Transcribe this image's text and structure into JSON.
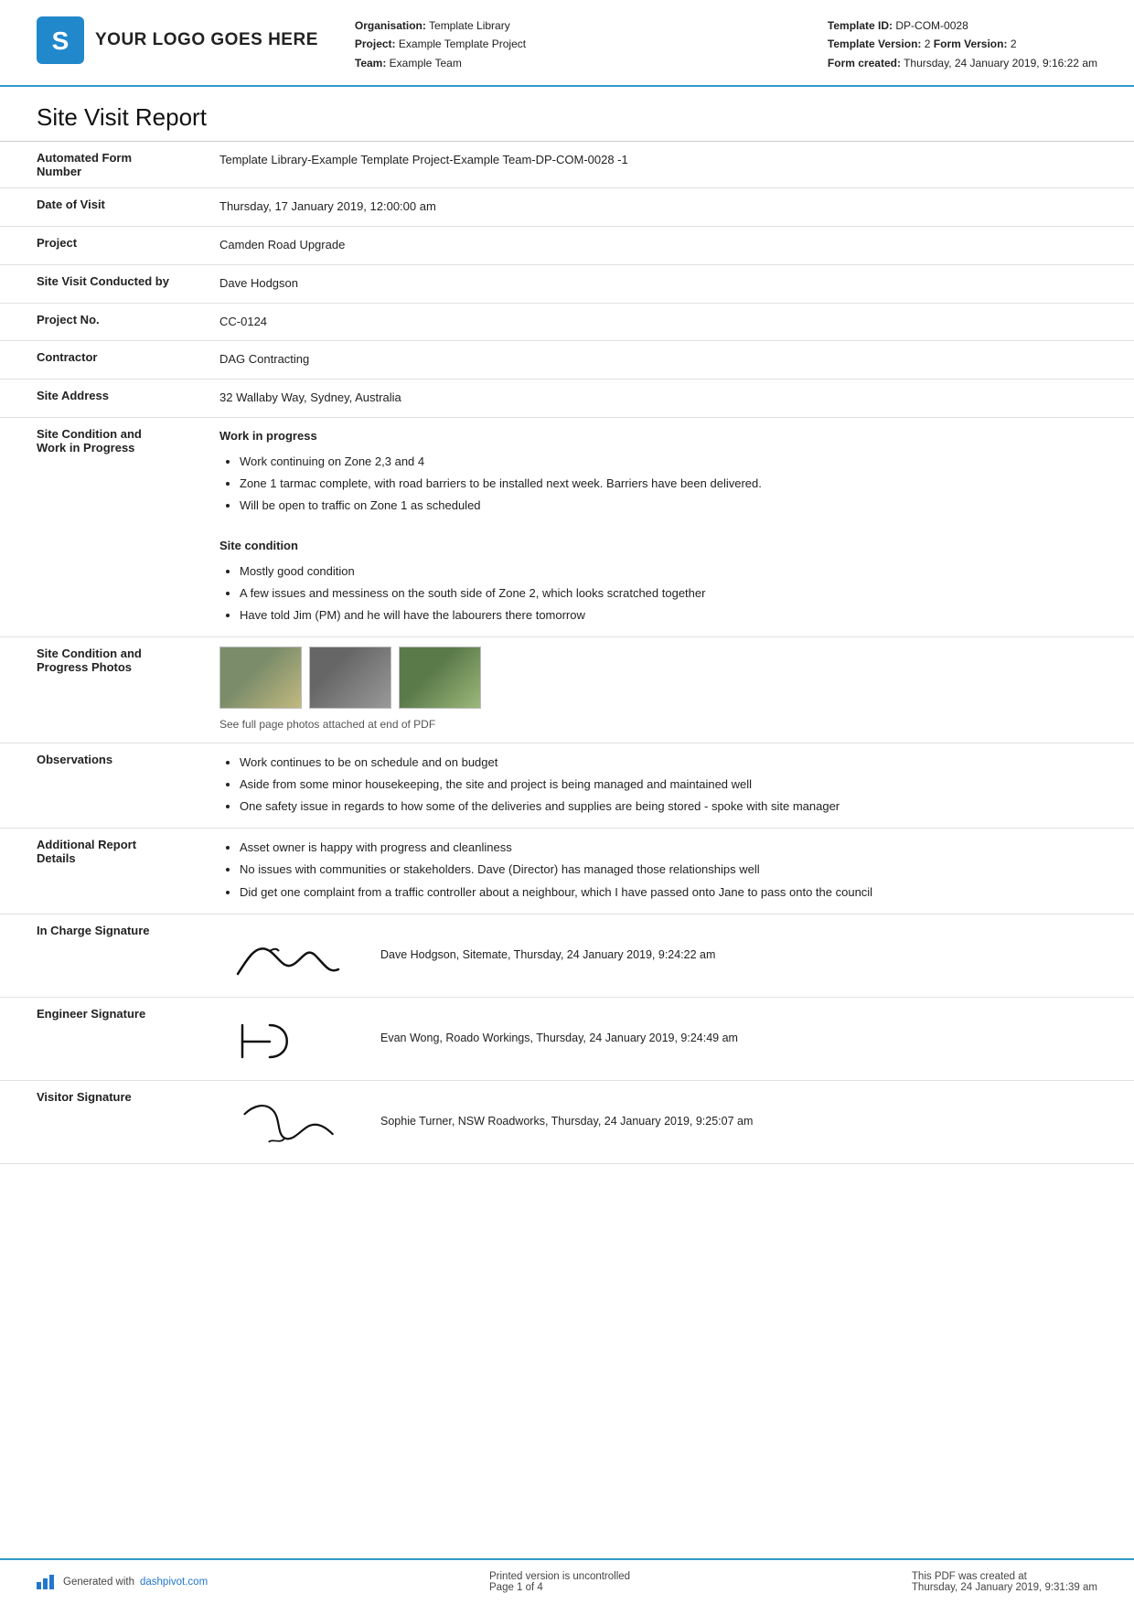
{
  "header": {
    "logo_text": "YOUR LOGO GOES HERE",
    "org_label": "Organisation:",
    "org_value": "Template Library",
    "project_label": "Project:",
    "project_value": "Example Template Project",
    "team_label": "Team:",
    "team_value": "Example Team",
    "template_id_label": "Template ID:",
    "template_id_value": "DP-COM-0028",
    "template_version_label": "Template Version:",
    "template_version_value": "2",
    "form_version_label": "Form Version:",
    "form_version_value": "2",
    "form_created_label": "Form created:",
    "form_created_value": "Thursday, 24 January 2019, 9:16:22 am"
  },
  "report": {
    "title": "Site Visit Report",
    "fields": {
      "form_number_label": "Automated Form Number",
      "form_number_value": "Template Library-Example Template Project-Example Team-DP-COM-0028   -1",
      "date_of_visit_label": "Date of Visit",
      "date_of_visit_value": "Thursday, 17 January 2019, 12:00:00 am",
      "project_label": "Project",
      "project_value": "Camden Road Upgrade",
      "site_visit_label": "Site Visit Conducted by",
      "site_visit_value": "Dave Hodgson",
      "project_no_label": "Project No.",
      "project_no_value": "CC-0124",
      "contractor_label": "Contractor",
      "contractor_value": "DAG Contracting",
      "site_address_label": "Site Address",
      "site_address_value": "32 Wallaby Way, Sydney, Australia",
      "site_condition_label": "Site Condition and Work in Progress",
      "site_condition_heading1": "Work in progress",
      "site_condition_bullets1": [
        "Work continuing on Zone 2,3 and 4",
        "Zone 1 tarmac complete, with road barriers to be installed next week. Barriers have been delivered.",
        "Will be open to traffic on Zone 1 as scheduled"
      ],
      "site_condition_heading2": "Site condition",
      "site_condition_bullets2": [
        "Mostly good condition",
        "A few issues and messiness on the south side of Zone 2, which looks scratched together",
        "Have told Jim (PM) and he will have the labourers there tomorrow"
      ],
      "photos_label": "Site Condition and Progress Photos",
      "photos_caption": "See full page photos attached at end of PDF",
      "observations_label": "Observations",
      "observations_bullets": [
        "Work continues to be on schedule and on budget",
        "Aside from some minor housekeeping, the site and project is being managed and maintained well",
        "One safety issue in regards to how some of the deliveries and supplies are being stored - spoke with site manager"
      ],
      "additional_label": "Additional Report Details",
      "additional_bullets": [
        "Asset owner is happy with progress and cleanliness",
        "No issues with communities or stakeholders. Dave (Director) has managed those relationships well",
        "Did get one complaint from a traffic controller about a neighbour, which I have passed onto Jane to pass onto the council"
      ],
      "in_charge_label": "In Charge Signature",
      "in_charge_sig_text": "Dave Hodgson, Sitemate, Thursday, 24 January 2019, 9:24:22 am",
      "engineer_label": "Engineer Signature",
      "engineer_sig_text": "Evan Wong, Roado Workings, Thursday, 24 January 2019, 9:24:49 am",
      "visitor_label": "Visitor Signature",
      "visitor_sig_text": "Sophie Turner, NSW Roadworks, Thursday, 24 January 2019, 9:25:07 am"
    }
  },
  "footer": {
    "generated_text": "Generated with ",
    "dashpivot_link": "dashpivot.com",
    "center_text": "Printed version is uncontrolled",
    "page_text": "Page 1 of 4",
    "right_text": "This PDF was created at",
    "right_date": "Thursday, 24 January 2019, 9:31:39 am"
  }
}
